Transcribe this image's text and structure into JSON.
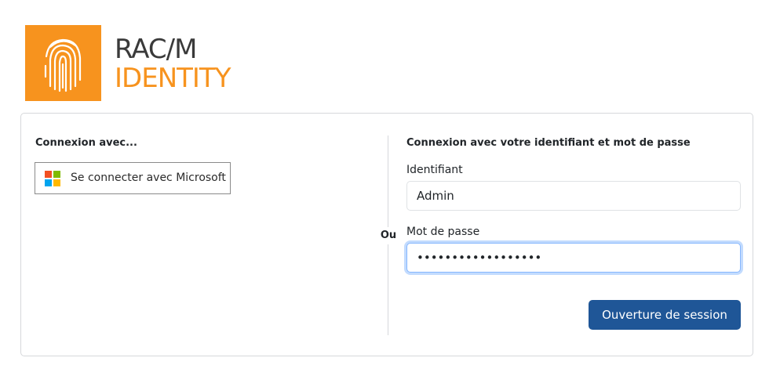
{
  "brand": {
    "line1": "RAC/M",
    "line2": "IDENTITY",
    "logo_icon": "fingerprint-icon",
    "accent_color": "#f7931e"
  },
  "left_panel": {
    "title": "Connexion avec...",
    "microsoft_button_label": "Se connecter avec Microsoft",
    "microsoft_icon": "microsoft-logo-icon"
  },
  "separator_label": "Ou",
  "right_panel": {
    "title": "Connexion avec votre identifiant et mot de passe",
    "username_label": "Identifiant",
    "username_value": "Admin",
    "password_label": "Mot de passe",
    "password_value": "••••••••••••••••••",
    "submit_label": "Ouverture de session",
    "submit_color": "#1f5697"
  }
}
